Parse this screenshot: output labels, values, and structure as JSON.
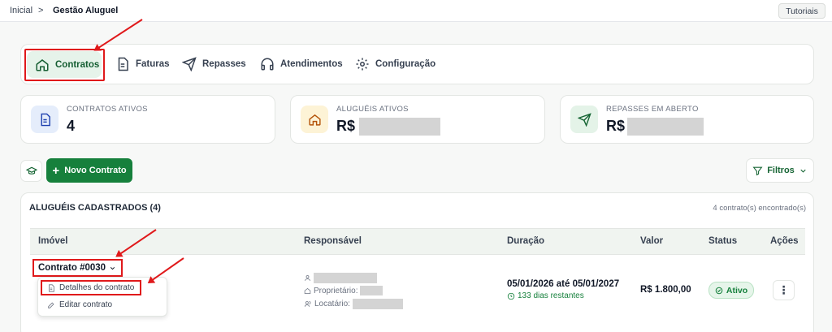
{
  "breadcrumb": {
    "home": "Inicial",
    "separator": ">",
    "current": "Gestão Aluguel"
  },
  "header": {
    "tutorials": "Tutoriais"
  },
  "tabs": [
    {
      "label": "Contratos",
      "icon": "home-icon",
      "active": true
    },
    {
      "label": "Faturas",
      "icon": "document-icon"
    },
    {
      "label": "Repasses",
      "icon": "send-icon"
    },
    {
      "label": "Atendimentos",
      "icon": "headphones-icon"
    },
    {
      "label": "Configuração",
      "icon": "gear-icon"
    }
  ],
  "stats": [
    {
      "label": "CONTRATOS ATIVOS",
      "value": "4",
      "icon": "document-icon",
      "color": "#e5edfb"
    },
    {
      "label": "ALUGUÉIS ATIVOS",
      "value": "R$",
      "icon": "home-icon",
      "color": "#fdf3d6"
    },
    {
      "label": "REPASSES EM ABERTO",
      "value": "R$",
      "icon": "send-icon",
      "color": "#e4f3e8"
    }
  ],
  "toolbar": {
    "new_contract": "Novo Contrato",
    "filters": "Filtros"
  },
  "list": {
    "title": "ALUGUÉIS CADASTRADOS (4)",
    "count": "4 contrato(s) encontrado(s)",
    "columns": {
      "property": "Imóvel",
      "responsible": "Responsável",
      "duration": "Duração",
      "value": "Valor",
      "status": "Status",
      "actions": "Ações"
    },
    "row": {
      "contract": "Contrato #0030",
      "owner_label": "Proprietário:",
      "tenant_label": "Locatário:",
      "duration": "05/01/2026 até 05/01/2027",
      "remaining": "133 dias restantes",
      "value": "R$ 1.800,00",
      "status": "Ativo"
    },
    "menu": {
      "details": "Detalhes do contrato",
      "edit": "Editar contrato"
    }
  },
  "colors": {
    "accent": "#16803c",
    "highlight": "#e0191b"
  }
}
